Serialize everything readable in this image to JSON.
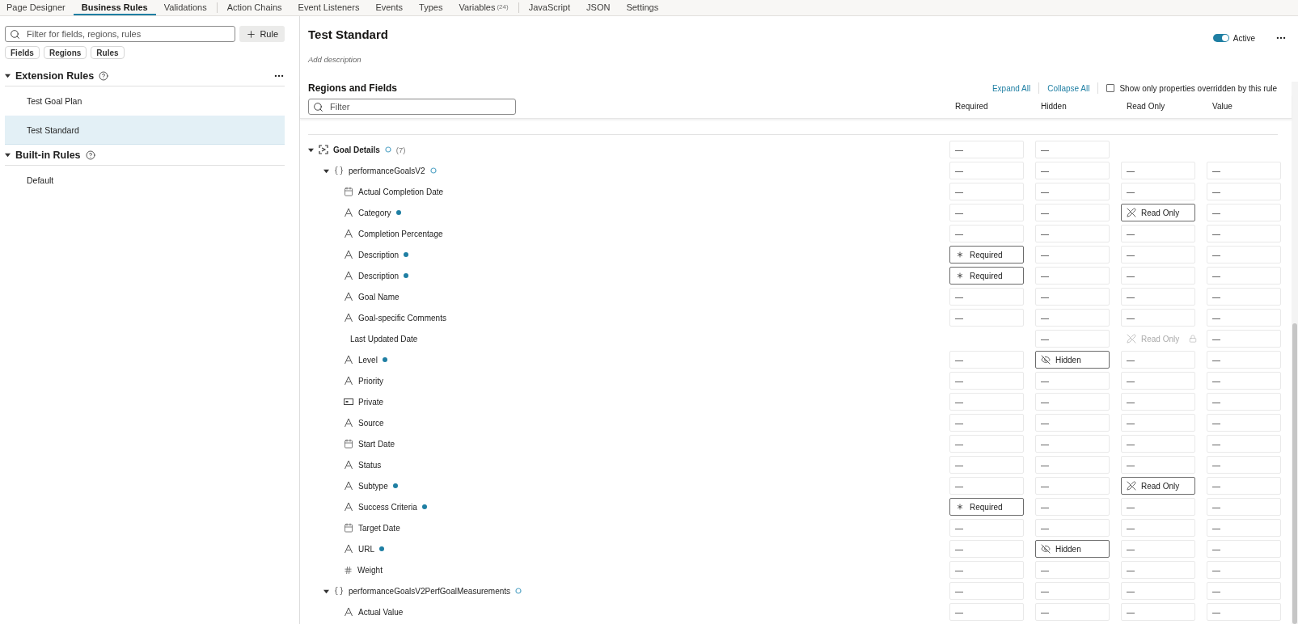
{
  "tab_groups": [
    [
      {
        "label": "Page Designer",
        "selected": false
      },
      {
        "label": "Business Rules",
        "selected": true
      },
      {
        "label": "Validations",
        "selected": false
      }
    ],
    [
      {
        "label": "Action Chains",
        "selected": false
      },
      {
        "label": "Event Listeners",
        "selected": false
      },
      {
        "label": "Events",
        "selected": false
      },
      {
        "label": "Types",
        "selected": false
      },
      {
        "label": "Variables",
        "count": "(24)",
        "selected": false
      }
    ],
    [
      {
        "label": "JavaScript",
        "selected": false
      },
      {
        "label": "JSON",
        "selected": false
      },
      {
        "label": "Settings",
        "selected": false
      }
    ]
  ],
  "rules_panel": {
    "search": {
      "placeholder": "Filter for fields, regions, rules"
    },
    "add_button": "Rule",
    "chips": [
      "Fields",
      "Regions",
      "Rules"
    ],
    "sections": [
      {
        "title": "Extension Rules",
        "expanded": true,
        "menu": true,
        "items": [
          {
            "label": "Test Goal Plan",
            "selected": false
          },
          {
            "label": "Test Standard",
            "selected": true
          }
        ]
      },
      {
        "title": "Built-in Rules",
        "expanded": true,
        "menu": false,
        "items": [
          {
            "label": "Default",
            "selected": false
          }
        ]
      }
    ]
  },
  "rule": {
    "title": "Test Standard",
    "description_placeholder": "Add description",
    "active": {
      "label": "Active",
      "on": true
    },
    "section_title": "Regions and Fields",
    "links": [
      "Expand All",
      "Collapse All"
    ],
    "override_filter": {
      "label": "Show only properties overridden by this rule",
      "checked": false
    },
    "filter": {
      "placeholder": "Filter"
    },
    "columns": [
      "Required",
      "Hidden",
      "Read Only",
      "Value"
    ],
    "tree": [
      {
        "label": "Goal Details",
        "kind": "region",
        "count": "(7)",
        "expanded": true,
        "cells": [
          {
            "kind": "dash",
            "text": "—"
          },
          {
            "kind": "dash",
            "text": "—"
          },
          {
            "kind": "none"
          },
          {
            "kind": "none"
          }
        ],
        "children": [
          {
            "label": "performanceGoalsV2",
            "kind": "object",
            "expanded": true,
            "cells": [
              {
                "kind": "dash",
                "text": "—"
              },
              {
                "kind": "dash",
                "text": "—"
              },
              {
                "kind": "dash",
                "text": "—"
              },
              {
                "kind": "dash",
                "text": "—"
              }
            ],
            "children": [
              {
                "label": "Actual Completion Date",
                "kind": "date",
                "modified": false,
                "cells": [
                  {
                    "kind": "dash",
                    "text": "—"
                  },
                  {
                    "kind": "dash",
                    "text": "—"
                  },
                  {
                    "kind": "dash",
                    "text": "—"
                  },
                  {
                    "kind": "dash",
                    "text": "—"
                  }
                ]
              },
              {
                "label": "Category",
                "kind": "text",
                "modified": true,
                "cells": [
                  {
                    "kind": "dash",
                    "text": "—"
                  },
                  {
                    "kind": "dash",
                    "text": "—"
                  },
                  {
                    "kind": "readonly",
                    "text": "Read Only"
                  },
                  {
                    "kind": "dash",
                    "text": "—"
                  }
                ]
              },
              {
                "label": "Completion Percentage",
                "kind": "text",
                "modified": false,
                "cells": [
                  {
                    "kind": "dash",
                    "text": "—"
                  },
                  {
                    "kind": "dash",
                    "text": "—"
                  },
                  {
                    "kind": "dash",
                    "text": "—"
                  },
                  {
                    "kind": "dash",
                    "text": "—"
                  }
                ]
              },
              {
                "label": "Description",
                "kind": "text",
                "modified": true,
                "cells": [
                  {
                    "kind": "required",
                    "text": "Required"
                  },
                  {
                    "kind": "dash",
                    "text": "—"
                  },
                  {
                    "kind": "dash",
                    "text": "—"
                  },
                  {
                    "kind": "dash",
                    "text": "—"
                  }
                ]
              },
              {
                "label": "Description",
                "kind": "text",
                "modified": true,
                "cells": [
                  {
                    "kind": "required",
                    "text": "Required"
                  },
                  {
                    "kind": "dash",
                    "text": "—"
                  },
                  {
                    "kind": "dash",
                    "text": "—"
                  },
                  {
                    "kind": "dash",
                    "text": "—"
                  }
                ]
              },
              {
                "label": "Goal Name",
                "kind": "text",
                "modified": false,
                "cells": [
                  {
                    "kind": "dash",
                    "text": "—"
                  },
                  {
                    "kind": "dash",
                    "text": "—"
                  },
                  {
                    "kind": "dash",
                    "text": "—"
                  },
                  {
                    "kind": "dash",
                    "text": "—"
                  }
                ]
              },
              {
                "label": "Goal-specific Comments",
                "kind": "text",
                "modified": false,
                "cells": [
                  {
                    "kind": "dash",
                    "text": "—"
                  },
                  {
                    "kind": "dash",
                    "text": "—"
                  },
                  {
                    "kind": "dash",
                    "text": "—"
                  },
                  {
                    "kind": "dash",
                    "text": "—"
                  }
                ]
              },
              {
                "label": "Last Updated Date",
                "kind": "plain",
                "modified": false,
                "cells": [
                  {
                    "kind": "none"
                  },
                  {
                    "kind": "dash",
                    "text": "—"
                  },
                  {
                    "kind": "locked",
                    "text": "Read Only"
                  },
                  {
                    "kind": "dash",
                    "text": "—"
                  }
                ]
              },
              {
                "label": "Level",
                "kind": "text",
                "modified": true,
                "cells": [
                  {
                    "kind": "dash",
                    "text": "—"
                  },
                  {
                    "kind": "hidden",
                    "text": "Hidden"
                  },
                  {
                    "kind": "dash",
                    "text": "—"
                  },
                  {
                    "kind": "dash",
                    "text": "—"
                  }
                ]
              },
              {
                "label": "Priority",
                "kind": "text",
                "modified": false,
                "cells": [
                  {
                    "kind": "dash",
                    "text": "—"
                  },
                  {
                    "kind": "dash",
                    "text": "—"
                  },
                  {
                    "kind": "dash",
                    "text": "—"
                  },
                  {
                    "kind": "dash",
                    "text": "—"
                  }
                ]
              },
              {
                "label": "Private",
                "kind": "switch",
                "modified": false,
                "cells": [
                  {
                    "kind": "dash",
                    "text": "—"
                  },
                  {
                    "kind": "dash",
                    "text": "—"
                  },
                  {
                    "kind": "dash",
                    "text": "—"
                  },
                  {
                    "kind": "dash",
                    "text": "—"
                  }
                ]
              },
              {
                "label": "Source",
                "kind": "text",
                "modified": false,
                "cells": [
                  {
                    "kind": "dash",
                    "text": "—"
                  },
                  {
                    "kind": "dash",
                    "text": "—"
                  },
                  {
                    "kind": "dash",
                    "text": "—"
                  },
                  {
                    "kind": "dash",
                    "text": "—"
                  }
                ]
              },
              {
                "label": "Start Date",
                "kind": "date",
                "modified": false,
                "cells": [
                  {
                    "kind": "dash",
                    "text": "—"
                  },
                  {
                    "kind": "dash",
                    "text": "—"
                  },
                  {
                    "kind": "dash",
                    "text": "—"
                  },
                  {
                    "kind": "dash",
                    "text": "—"
                  }
                ]
              },
              {
                "label": "Status",
                "kind": "text",
                "modified": false,
                "cells": [
                  {
                    "kind": "dash",
                    "text": "—"
                  },
                  {
                    "kind": "dash",
                    "text": "—"
                  },
                  {
                    "kind": "dash",
                    "text": "—"
                  },
                  {
                    "kind": "dash",
                    "text": "—"
                  }
                ]
              },
              {
                "label": "Subtype",
                "kind": "text",
                "modified": true,
                "cells": [
                  {
                    "kind": "dash",
                    "text": "—"
                  },
                  {
                    "kind": "dash",
                    "text": "—"
                  },
                  {
                    "kind": "readonly",
                    "text": "Read Only"
                  },
                  {
                    "kind": "dash",
                    "text": "—"
                  }
                ]
              },
              {
                "label": "Success Criteria",
                "kind": "text",
                "modified": true,
                "cells": [
                  {
                    "kind": "required",
                    "text": "Required"
                  },
                  {
                    "kind": "dash",
                    "text": "—"
                  },
                  {
                    "kind": "dash",
                    "text": "—"
                  },
                  {
                    "kind": "dash",
                    "text": "—"
                  }
                ]
              },
              {
                "label": "Target Date",
                "kind": "date",
                "modified": false,
                "cells": [
                  {
                    "kind": "dash",
                    "text": "—"
                  },
                  {
                    "kind": "dash",
                    "text": "—"
                  },
                  {
                    "kind": "dash",
                    "text": "—"
                  },
                  {
                    "kind": "dash",
                    "text": "—"
                  }
                ]
              },
              {
                "label": "URL",
                "kind": "text",
                "modified": true,
                "cells": [
                  {
                    "kind": "dash",
                    "text": "—"
                  },
                  {
                    "kind": "hidden",
                    "text": "Hidden"
                  },
                  {
                    "kind": "dash",
                    "text": "—"
                  },
                  {
                    "kind": "dash",
                    "text": "—"
                  }
                ]
              },
              {
                "label": "Weight",
                "kind": "number",
                "modified": false,
                "cells": [
                  {
                    "kind": "dash",
                    "text": "—"
                  },
                  {
                    "kind": "dash",
                    "text": "—"
                  },
                  {
                    "kind": "dash",
                    "text": "—"
                  },
                  {
                    "kind": "dash",
                    "text": "—"
                  }
                ]
              }
            ]
          },
          {
            "label": "performanceGoalsV2PerfGoalMeasurements",
            "kind": "object",
            "expanded": true,
            "cells": [
              {
                "kind": "dash",
                "text": "—"
              },
              {
                "kind": "dash",
                "text": "—"
              },
              {
                "kind": "dash",
                "text": "—"
              },
              {
                "kind": "dash",
                "text": "—"
              }
            ],
            "children": [
              {
                "label": "Actual Value",
                "kind": "text",
                "modified": false,
                "cells": [
                  {
                    "kind": "dash",
                    "text": "—"
                  },
                  {
                    "kind": "dash",
                    "text": "—"
                  },
                  {
                    "kind": "dash",
                    "text": "—"
                  },
                  {
                    "kind": "dash",
                    "text": "—"
                  }
                ]
              }
            ]
          }
        ]
      }
    ]
  }
}
